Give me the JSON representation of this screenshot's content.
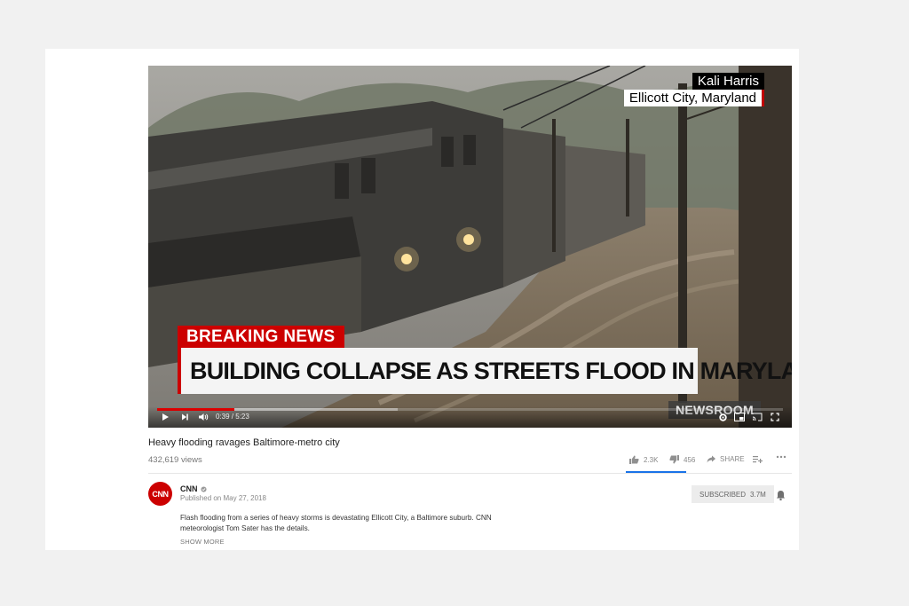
{
  "video": {
    "lower_third_name": "Kali Harris",
    "lower_third_location": "Ellicott City, Maryland",
    "breaking_label": "BREAKING NEWS",
    "headline": "BUILDING COLLAPSE AS STREETS FLOOD IN MARYLAND",
    "bug": "NEWSROOM",
    "time_display": "0:39 / 5:23",
    "played_fraction": 0.124,
    "buffered_fraction": 0.385
  },
  "info": {
    "title": "Heavy flooding ravages Baltimore-metro city",
    "views": "432,619 views",
    "likes": "2.3K",
    "dislikes": "456",
    "share_label": "SHARE"
  },
  "channel": {
    "logo_text": "CNN",
    "name": "CNN",
    "published": "Published on May 27, 2018",
    "subscribe_label": "SUBSCRIBED",
    "subscriber_count": "3.7M"
  },
  "description": {
    "text": "Flash flooding from a series of heavy storms is devastating Ellicott City, a Baltimore suburb. CNN meteorologist Tom Sater has the details.",
    "show_more": "SHOW MORE"
  },
  "icons": {
    "play": "play-icon",
    "next": "next-icon",
    "volume": "volume-icon",
    "settings": "settings-icon",
    "miniplayer": "miniplayer-icon",
    "cast": "cast-icon",
    "fullscreen": "fullscreen-icon",
    "like": "thumbs-up-icon",
    "dislike": "thumbs-down-icon",
    "share": "share-icon",
    "add_to_playlist": "add-to-playlist-icon",
    "more": "more-icon",
    "verified": "verified-icon",
    "bell": "bell-icon"
  },
  "colors": {
    "brand_red": "#cc0000",
    "progress_red": "#ee0000",
    "like_underline": "#1a73e8"
  }
}
